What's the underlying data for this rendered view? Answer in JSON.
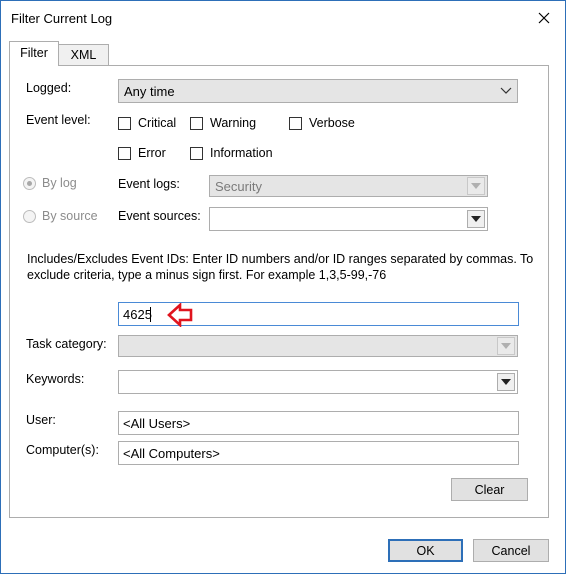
{
  "window": {
    "title": "Filter Current Log"
  },
  "tabs": [
    {
      "label": "Filter",
      "active": true
    },
    {
      "label": "XML",
      "active": false
    }
  ],
  "filter": {
    "logged_label": "Logged:",
    "logged_value": "Any time",
    "event_level_label": "Event level:",
    "levels": [
      {
        "label": "Critical",
        "checked": false
      },
      {
        "label": "Warning",
        "checked": false
      },
      {
        "label": "Verbose",
        "checked": false
      },
      {
        "label": "Error",
        "checked": false
      },
      {
        "label": "Information",
        "checked": false
      }
    ],
    "by_log_label": "By log",
    "by_source_label": "By source",
    "event_logs_label": "Event logs:",
    "event_logs_value": "Security",
    "event_sources_label": "Event sources:",
    "event_sources_value": "",
    "ids_description": "Includes/Excludes Event IDs: Enter ID numbers and/or ID ranges separated by commas. To exclude criteria, type a minus sign first. For example 1,3,5-99,-76",
    "event_ids_value": "4625",
    "task_category_label": "Task category:",
    "task_category_value": "",
    "keywords_label": "Keywords:",
    "keywords_value": "",
    "user_label": "User:",
    "user_value": "<All Users>",
    "computers_label": "Computer(s):",
    "computers_value": "<All Computers>",
    "clear_label": "Clear"
  },
  "footer": {
    "ok_label": "OK",
    "cancel_label": "Cancel"
  },
  "colors": {
    "accent": "#2d6fb8",
    "annotation_arrow": "#e0141e"
  },
  "icons": [
    "close-icon",
    "chevron-down-icon",
    "dropdown-arrow-icon",
    "red-arrow-annotation"
  ]
}
